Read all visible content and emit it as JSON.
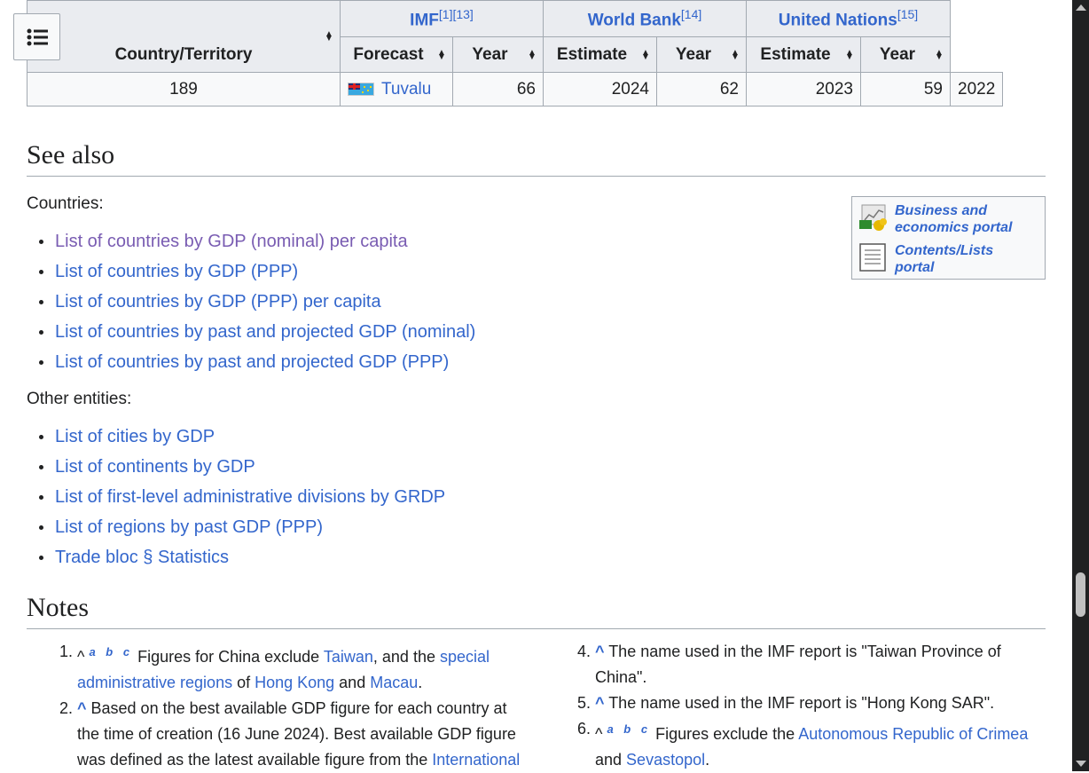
{
  "table": {
    "country_header": "Country/Territory",
    "groups": [
      {
        "name": "IMF",
        "refs": "[1][13]"
      },
      {
        "name": "World Bank",
        "refs": "[14]"
      },
      {
        "name": "United Nations",
        "refs": "[15]"
      }
    ],
    "subheaders": [
      "Forecast",
      "Year",
      "Estimate",
      "Year",
      "Estimate",
      "Year"
    ],
    "row": {
      "rank": "189",
      "country": "Tuvalu",
      "values": [
        "66",
        "2024",
        "62",
        "2023",
        "59",
        "2022"
      ]
    }
  },
  "toc_button": {
    "icon": "list-icon"
  },
  "see_also": {
    "heading": "See also",
    "countries_label": "Countries:",
    "countries_links": [
      "List of countries by GDP (nominal) per capita",
      "List of countries by GDP (PPP)",
      "List of countries by GDP (PPP) per capita",
      "List of countries by past and projected GDP (nominal)",
      "List of countries by past and projected GDP (PPP)"
    ],
    "other_label": "Other entities:",
    "other_links": [
      "List of cities by GDP",
      "List of continents by GDP",
      "List of first-level administrative divisions by GRDP",
      "List of regions by past GDP (PPP)",
      "Trade bloc § Statistics"
    ]
  },
  "portals": [
    {
      "line1": "Business and",
      "line2": "economics portal",
      "icon": "business-portal-icon"
    },
    {
      "line1": "Contents/Lists",
      "line2": "portal",
      "icon": "contents-portal-icon"
    }
  ],
  "notes": {
    "heading": "Notes",
    "left": [
      {
        "num": "1.",
        "caret": "^",
        "abc": "a b c",
        "t1": " Figures for China exclude ",
        "l1": "Taiwan",
        "t2": ", and the ",
        "l2": "special administrative regions",
        "t3": " of ",
        "l3": "Hong Kong",
        "t4": " and ",
        "l4": "Macau",
        "t5": "."
      },
      {
        "num": "2.",
        "caret": "^",
        "t1": " Based on the best available GDP figure for each country at the time of creation (16 June 2024). Best available GDP figure was defined as the latest available figure from the ",
        "l1": "International"
      }
    ],
    "right": [
      {
        "num": "4.",
        "caret": "^",
        "t1": " The name used in the IMF report is \"Taiwan Province of China\"."
      },
      {
        "num": "5.",
        "caret": "^",
        "t1": " The name used in the IMF report is \"Hong Kong SAR\"."
      },
      {
        "num": "6.",
        "caret": "^",
        "abc": "a b c",
        "t1": " Figures exclude the ",
        "l1": "Autonomous Republic of Crimea",
        "t2": " and ",
        "l2": "Sevastopol",
        "t3": "."
      }
    ]
  },
  "colors": {
    "link": "#3366cc",
    "visited": "#795cb2",
    "header_bg": "#eaecf0",
    "border": "#a2a9b1"
  }
}
